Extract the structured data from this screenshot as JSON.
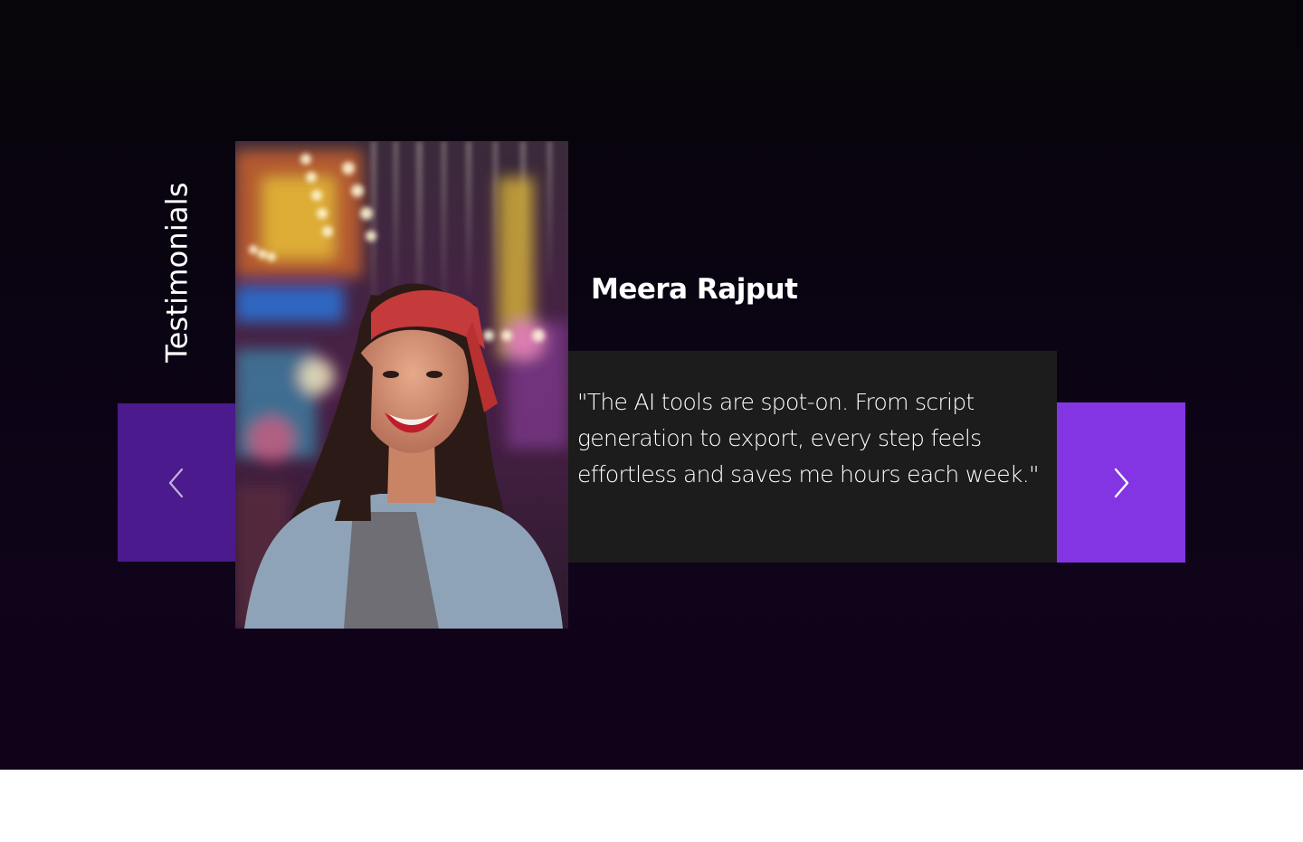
{
  "section": {
    "heading": "Testimonials"
  },
  "testimonial": {
    "author": "Meera Rajput",
    "quote": "\"The AI tools are spot-on. From script generation to export, every step feels effortless and saves me hours each week.\"",
    "photo_alt": "Smiling woman with red bandana at a carnival"
  },
  "controls": {
    "prev_icon": "chevron-left-icon",
    "next_icon": "chevron-right-icon"
  },
  "colors": {
    "background_top": "#070509",
    "background_bottom": "#110119",
    "prev_button": "#4b1a8c",
    "next_button": "#8335e3",
    "quote_box": "#1c1c1c",
    "text": "#ffffff"
  }
}
